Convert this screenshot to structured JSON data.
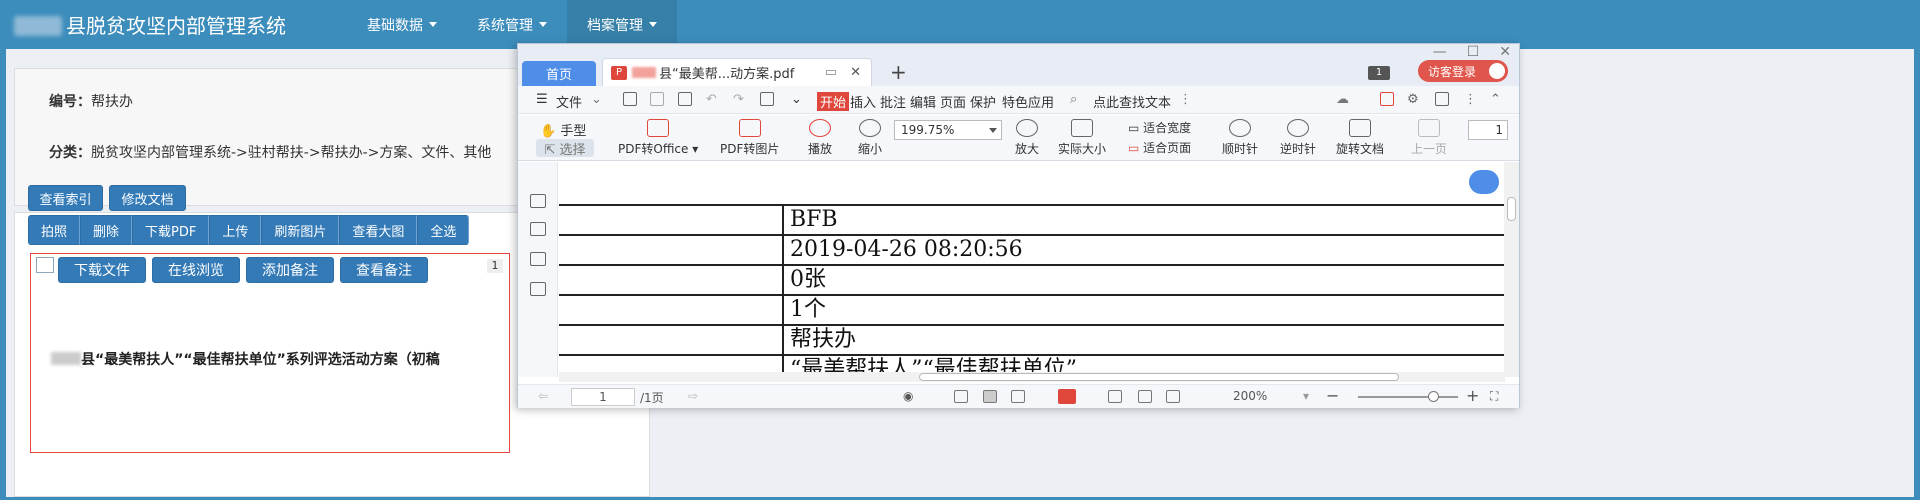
{
  "app": {
    "title": "县脱贫攻坚内部管理系统",
    "nav": [
      {
        "label": "基础数据"
      },
      {
        "label": "系统管理"
      },
      {
        "label": "档案管理"
      }
    ]
  },
  "info": {
    "number_label": "编号：",
    "number_value": "帮扶办",
    "category_label": "分类：",
    "category_value": "脱贫攻坚内部管理系统->驻村帮扶->帮扶办->方案、文件、其他"
  },
  "actions": {
    "view_index": "查看索引",
    "edit_doc": "修改文档",
    "group": [
      "拍照",
      "删除",
      "下载PDF",
      "上传",
      "刷新图片",
      "查看大图",
      "全选"
    ]
  },
  "file_card": {
    "buttons": [
      "下载文件",
      "在线浏览",
      "添加备注",
      "查看备注"
    ],
    "index": "1",
    "title": "县“最美帮扶人”“最佳帮扶单位”系列评选活动方案（初稿"
  },
  "wps": {
    "window_controls": [
      "—",
      "☐",
      "✕"
    ],
    "tab_home": "首页",
    "tab_doc": "县“最美帮...动方案.pdf",
    "tab_pdf_badge": "P",
    "page_badge": "1",
    "visitor": "访客登录",
    "menu": {
      "file": "文件",
      "start": "开始",
      "items": [
        "插入",
        "批注",
        "编辑",
        "页面",
        "保护",
        "特色应用"
      ],
      "search": "点此查找文本"
    },
    "toolbar": {
      "hand": "手型",
      "select": "选择",
      "pdf_office": "PDF转Office",
      "pdf_image": "PDF转图片",
      "play": "播放",
      "zoom_out": "缩小",
      "zoom_value": "199.75%",
      "zoom_in": "放大",
      "actual": "实际大小",
      "fit_width": "适合宽度",
      "fit_page": "适合页面",
      "rotate_cw": "顺时针",
      "rotate_ccw": "逆时针",
      "rotate_doc": "旋转文档",
      "prev_page": "上一页",
      "page_value": "1"
    },
    "doc_rows": [
      "BFB",
      "2019-04-26 08:20:56",
      "0张",
      "1个",
      "帮扶办",
      "“最美帮扶人”“最佳帮扶单位”"
    ],
    "status": {
      "page": "1",
      "total": "/1页",
      "zoom": "200%"
    }
  }
}
